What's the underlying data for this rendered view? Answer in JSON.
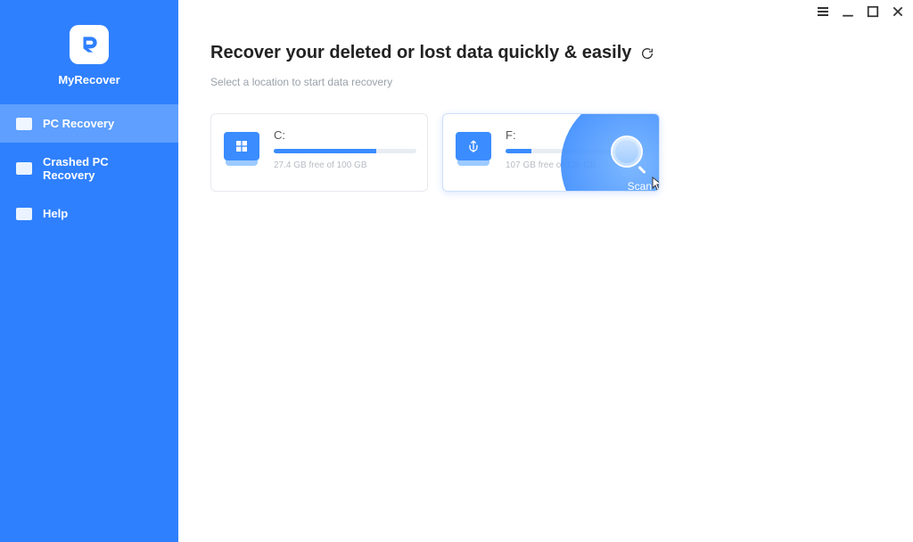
{
  "brand": "MyRecover",
  "sidebar": {
    "items": [
      {
        "label": "PC Recovery",
        "active": true
      },
      {
        "label": "Crashed PC Recovery",
        "active": false
      },
      {
        "label": "Help",
        "active": false
      }
    ]
  },
  "header": {
    "title": "Recover your deleted or lost data quickly & easily",
    "subtitle": "Select a location to start data recovery"
  },
  "drives": [
    {
      "letter": "C:",
      "type": "windows",
      "free": "27.4 GB free of 100 GB",
      "used_pct": 72
    },
    {
      "letter": "F:",
      "type": "usb",
      "free": "107 GB free of 130 GB",
      "used_pct": 18,
      "hover": true
    }
  ],
  "scan_label": "Scan",
  "colors": {
    "accent": "#2f80ff",
    "accent_light": "#5e9fff",
    "bar_fill": "#3b8cff"
  }
}
